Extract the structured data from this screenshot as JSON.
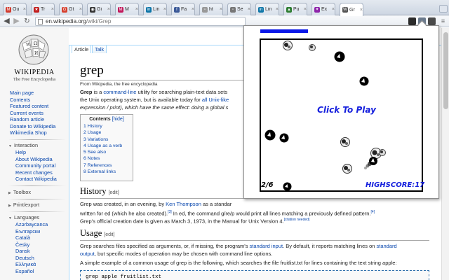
{
  "browser": {
    "tabs": [
      {
        "label": "Ou",
        "color": "#d23b2e",
        "glyph": "M"
      },
      {
        "label": "Tr",
        "color": "#c21f1f",
        "glyph": "★"
      },
      {
        "label": "Gt",
        "color": "#d6412f",
        "glyph": "G"
      },
      {
        "label": "Gi",
        "color": "#333333",
        "glyph": "◉"
      },
      {
        "label": "M",
        "color": "#c2185b",
        "glyph": "M"
      },
      {
        "label": "Lin",
        "color": "#0e76a8",
        "glyph": "in"
      },
      {
        "label": "Fa",
        "color": "#3b5998",
        "glyph": "f"
      },
      {
        "label": "ht",
        "color": "#999999",
        "glyph": "▫"
      },
      {
        "label": "Se",
        "color": "#777777",
        "glyph": "▫"
      },
      {
        "label": "Lin",
        "color": "#0e76a8",
        "glyph": "in"
      },
      {
        "label": "Pu",
        "color": "#2e7d32",
        "glyph": "▲"
      },
      {
        "label": "Ex",
        "color": "#8e24aa",
        "glyph": "✦"
      },
      {
        "label": "Gr",
        "color": "#555555",
        "glyph": "W"
      }
    ],
    "url_host": "en.wikipedia.org",
    "url_path": "/wiki/Grep"
  },
  "wiki": {
    "logo_title": "WIKIPEDIA",
    "logo_sub": "The Free Encyclopedia",
    "nav_main": [
      "Main page",
      "Contents",
      "Featured content",
      "Current events",
      "Random article",
      "Donate to Wikipedia",
      "Wikimedia Shop"
    ],
    "interaction_head": "Interaction",
    "interaction": [
      "Help",
      "About Wikipedia",
      "Community portal",
      "Recent changes",
      "Contact Wikipedia"
    ],
    "toolbox_head": "Toolbox",
    "print_head": "Print/export",
    "languages_head": "Languages",
    "languages": [
      "Azərbaycanca",
      "Български",
      "Català",
      "Česky",
      "Dansk",
      "Deutsch",
      "Ελληνικά",
      "Español"
    ],
    "tab_article": "Article",
    "tab_talk": "Talk",
    "title": "grep",
    "from": "From Wikipedia, the free encyclopedia",
    "intro1_bold": "Grep",
    "intro1_a": " is a ",
    "intro1_link": "command-line",
    "intro1_b": " utility for searching plain-text data sets",
    "intro2_a": "the Unix operating system, but is available today for ",
    "intro2_link": "all Unix-like",
    "intro3": "expression / print), which have the same effect: doing a global s",
    "toc_title": "Contents",
    "toc_hide": "[hide]",
    "toc": [
      "1 History",
      "2 Usage",
      "3 Variations",
      "4 Usage as a verb",
      "5 See also",
      "6 Notes",
      "7 References",
      "8 External links"
    ],
    "history_heading": "History",
    "edit_label": "[edit]",
    "history1_a": "Grep was created, in an evening, by ",
    "history1_link": "Ken Thompson",
    "history1_b": " as a standar",
    "history2": "written for ed (which he also created).",
    "history2_b": " In ed, the command g/re/p would print all lines matching a previously defined pattern.",
    "history3": "Grep's official creation date is given as March 3, 1973, in the Manual for Unix Version 4.",
    "cite1": "[3]",
    "cite2": "[4]",
    "citation_needed": "[citation needed]",
    "usage_heading": "Usage",
    "usage1_a": "Grep searches files specified as arguments, or, if missing, the program's ",
    "usage1_link": "standard input",
    "usage1_b": ". By default, it reports matching lines on ",
    "usage1_link2": "standard",
    "usage2_link": "output",
    "usage2_b": ", but specific modes of operation may be chosen with command line options.",
    "usage3": "A simple example of a common usage of grep is the following, which searches the file fruitlist.txt for lines containing the text string apple:",
    "code": "grep apple fruitlist.txt"
  },
  "game": {
    "click_to_play": "Click To Play",
    "level": "2/6",
    "highscore": "HIGHSCORE:17",
    "energy_level": 0.3
  }
}
